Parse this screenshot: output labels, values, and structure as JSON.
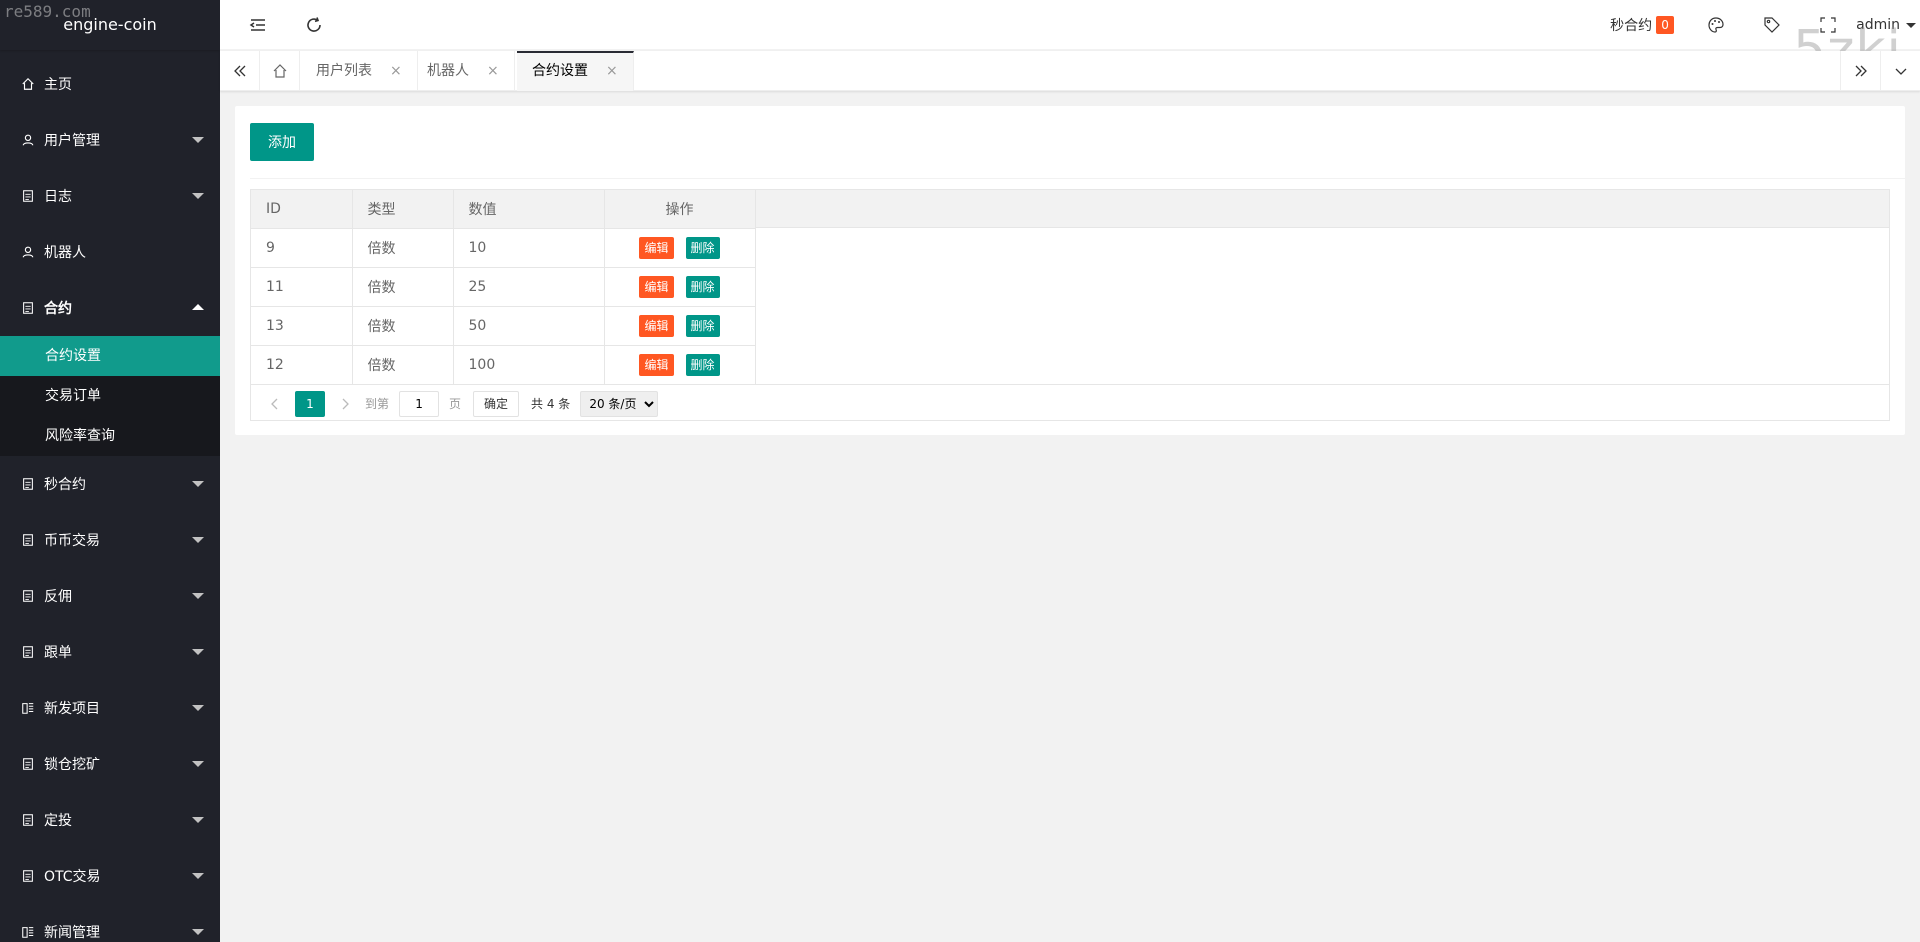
{
  "watermarks": {
    "top_left": "re589.com",
    "top_right": "5zki"
  },
  "sidebar": {
    "logo": "engine-coin",
    "items": [
      {
        "label": "主页",
        "icon": "home-icon",
        "expandable": false
      },
      {
        "label": "用户管理",
        "icon": "user-icon",
        "expandable": true
      },
      {
        "label": "日志",
        "icon": "doc-icon",
        "expandable": true
      },
      {
        "label": "机器人",
        "icon": "user-icon",
        "expandable": false
      },
      {
        "label": "合约",
        "icon": "doc-icon",
        "expandable": true,
        "expanded": true
      }
    ],
    "contract_sub": [
      {
        "label": "合约设置",
        "active": true
      },
      {
        "label": "交易订单"
      },
      {
        "label": "风险率查询"
      }
    ],
    "items_after": [
      {
        "label": "秒合约",
        "icon": "doc-icon"
      },
      {
        "label": "币币交易",
        "icon": "doc-icon"
      },
      {
        "label": "反佣",
        "icon": "doc-icon"
      },
      {
        "label": "跟单",
        "icon": "doc-icon"
      },
      {
        "label": "新发项目",
        "icon": "list-icon"
      },
      {
        "label": "锁仓挖矿",
        "icon": "doc-icon"
      },
      {
        "label": "定投",
        "icon": "doc-icon"
      },
      {
        "label": "OTC交易",
        "icon": "doc-icon"
      },
      {
        "label": "新闻管理",
        "icon": "list-icon"
      }
    ]
  },
  "header": {
    "sec_contract_label": "秒合约",
    "sec_contract_badge": "0",
    "user": "admin"
  },
  "tabs": {
    "items": [
      {
        "label": "用户列表"
      },
      {
        "label": "机器人"
      },
      {
        "label": "合约设置",
        "active": true
      }
    ],
    "close": "×"
  },
  "content": {
    "add_button": "添加",
    "columns": [
      "ID",
      "类型",
      "数值",
      "操作"
    ],
    "rows": [
      {
        "id": "9",
        "type": "倍数",
        "value": "10"
      },
      {
        "id": "11",
        "type": "倍数",
        "value": "25"
      },
      {
        "id": "13",
        "type": "倍数",
        "value": "50"
      },
      {
        "id": "12",
        "type": "倍数",
        "value": "100"
      }
    ],
    "edit_label": "编辑",
    "delete_label": "删除",
    "pager": {
      "current_page": "1",
      "goto_label": "到第",
      "goto_value": "1",
      "page_unit": "页",
      "confirm": "确定",
      "total": "共 4 条",
      "page_size": "20 条/页"
    }
  },
  "colors": {
    "sidebar_bg": "#20222a",
    "accent": "#009688",
    "danger": "#ff5722"
  }
}
